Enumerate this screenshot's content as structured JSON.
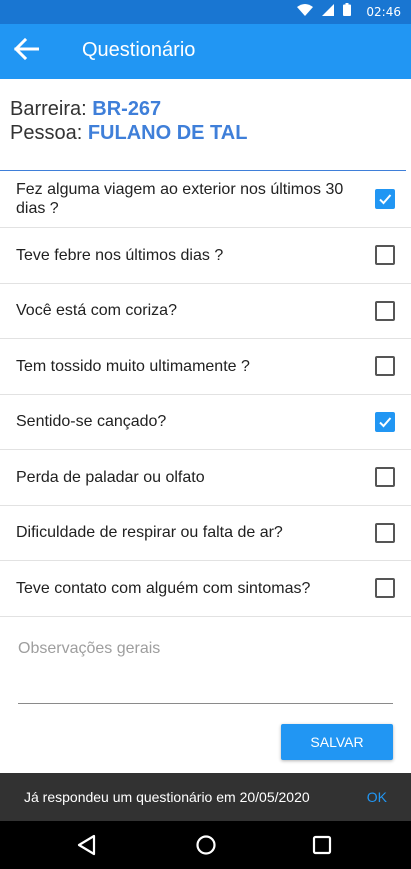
{
  "status_bar": {
    "time": "02:46",
    "icons": [
      "wifi-icon",
      "signal-icon",
      "battery-icon"
    ]
  },
  "app_bar": {
    "title": "Questionário",
    "back_icon": "arrow-left-icon"
  },
  "info": {
    "barreira_label": "Barreira:",
    "barreira_value": "BR-267",
    "pessoa_label": "Pessoa:",
    "pessoa_value": "FULANO DE TAL"
  },
  "questions": [
    {
      "text": "Fez alguma viagem ao exterior nos últimos 30 dias ?",
      "checked": true
    },
    {
      "text": "Teve febre nos últimos dias ?",
      "checked": false
    },
    {
      "text": "Você está com coriza?",
      "checked": false
    },
    {
      "text": "Tem tossido muito ultimamente ?",
      "checked": false
    },
    {
      "text": "Sentido-se cançado?",
      "checked": true
    },
    {
      "text": "Perda de paladar ou olfato",
      "checked": false
    },
    {
      "text": "Dificuldade de respirar ou falta de ar?",
      "checked": false
    },
    {
      "text": "Teve contato com alguém com sintomas?",
      "checked": false
    }
  ],
  "observations": {
    "placeholder": "Observações gerais",
    "value": ""
  },
  "save_button": "SALVAR",
  "snackbar": {
    "message": "Já respondeu um questionário em 20/05/2020",
    "action": "OK"
  },
  "nav_bar": {
    "icons": [
      "back-triangle-icon",
      "home-circle-icon",
      "recents-square-icon"
    ]
  },
  "colors": {
    "primary": "#2196f3",
    "primary_dark": "#1976d2",
    "accent_text": "#3f7fd9",
    "snackbar_bg": "#323232"
  }
}
